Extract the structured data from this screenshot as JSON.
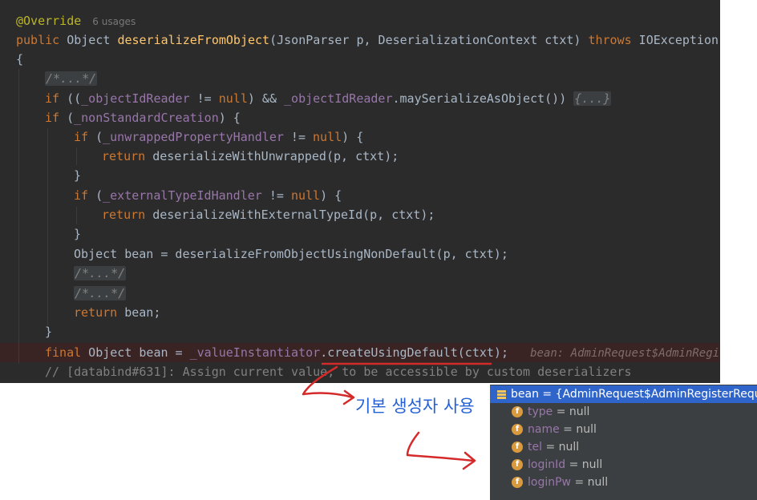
{
  "editor": {
    "annotation": "@Override",
    "usages": "6 usages",
    "decl_kw": "public",
    "decl_type": "Object",
    "method_name": "deserializeFromObject",
    "params": "(JsonParser p, DeserializationContext ctxt)",
    "throws_kw": "throws",
    "exception": "IOException",
    "open_brace": "{",
    "fold_block_comment": "/*...*/",
    "if_kw": "if",
    "objid_open": " ((",
    "objid_field": "_objectIdReader",
    "neq": " != ",
    "null_kw": "null",
    "and_part": ") && ",
    "objid_call": ".maySerializeAsObject())",
    "fold_braces": "{...}",
    "nonstd_open": " (",
    "nonstd_field": "_nonStandardCreation",
    "paren_brace": ") {",
    "unwrapped_field": "_unwrappedPropertyHandler",
    "return_kw": "return",
    "ret_unwrapped": " deserializeWithUnwrapped(p, ctxt);",
    "close_brace": "}",
    "external_field": "_externalTypeIdHandler",
    "ret_external": " deserializeWithExternalTypeId(p, ctxt);",
    "bean_decl": "Object bean = deserializeFromObjectUsingNonDefault(p, ctxt);",
    "return_bean": " bean;",
    "final_kw": "final",
    "final_mid": " Object bean = ",
    "value_field": "_valueInstantiator",
    "create_call": ".createUsingDefault(ctxt);",
    "inline_hint": "bean: AdminRequest$AdminRegis",
    "comment_line": "// [databind#631]: Assign current value, to be accessible by custom deserializers"
  },
  "note": {
    "text": "기본 생성자 사용"
  },
  "debugger": {
    "root": {
      "name": "bean",
      "value": " = {AdminRequest$AdminRegisterRequest@"
    },
    "fields": [
      {
        "name": "type",
        "value": " = null"
      },
      {
        "name": "name",
        "value": " = null"
      },
      {
        "name": "tel",
        "value": " = null"
      },
      {
        "name": "loginId",
        "value": " = null"
      },
      {
        "name": "loginPw",
        "value": " = null"
      }
    ],
    "field_badge": "f"
  },
  "colors": {
    "editor_bg": "#2b2b2b",
    "keyword": "#cc7832",
    "method": "#ffc66d",
    "field": "#9876aa",
    "annotation": "#bbb529",
    "note_blue": "#2561d6",
    "pen_red": "#d42a2a",
    "debug_selected": "#2f65ca"
  }
}
